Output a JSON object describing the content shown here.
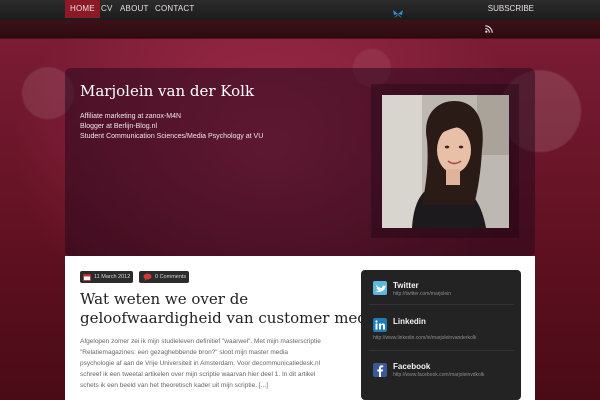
{
  "nav": {
    "items": [
      {
        "label": "HOME"
      },
      {
        "label": "CV"
      },
      {
        "label": "ABOUT"
      },
      {
        "label": "CONTACT"
      }
    ],
    "subscribe_label": "SUBSCRIBE"
  },
  "header": {
    "title": "Marjolein van der Kolk",
    "taglines": [
      "Affiliate marketing at zanox-M4N",
      "Blogger at Berlijn-Blog.nl",
      "Student Communication Sciences/Media Psychology at VU"
    ]
  },
  "post": {
    "date": "11 March 2012",
    "comments": "0 Comments",
    "title_lines": [
      "Wat weten we over de",
      "geloofwaardigheid van customer media?"
    ],
    "excerpt_lines": [
      "Afgelopen zomer zei ik mijn studieleven definitief \"waarwel\". Met mijn masterscriptie",
      "\"Relatiemagazines: een gezaghebbende bron?\" sloot mijn master media",
      "psychologie af aan de Vrije Universiteit in Amsterdam. Voor decommunicatiedesk.nl",
      "schreef ik een tweetal artikelen over mijn scriptie waarvan hier deel 1. In dit artikel",
      "schets ik een beeld van het theoretisch kader uit mijn scriptie. [...]"
    ]
  },
  "social": [
    {
      "name": "Twitter",
      "url": "http://twitter.com/marjolein",
      "icon": "twitter-icon",
      "color": "#5bb8de"
    },
    {
      "name": "Linkedin",
      "url": "http://www.linkedin.com/in/marjoleinvanderkolk",
      "icon": "linkedin-icon",
      "color": "#1f7bb6"
    },
    {
      "name": "Facebook",
      "url": "http://www.facebook.com/marjoleinvdkolk",
      "icon": "facebook-icon",
      "color": "#3b5998"
    }
  ],
  "colors": {
    "accent": "#8c1a26",
    "background": "#5a0f1c",
    "sidebar": "#232323"
  }
}
